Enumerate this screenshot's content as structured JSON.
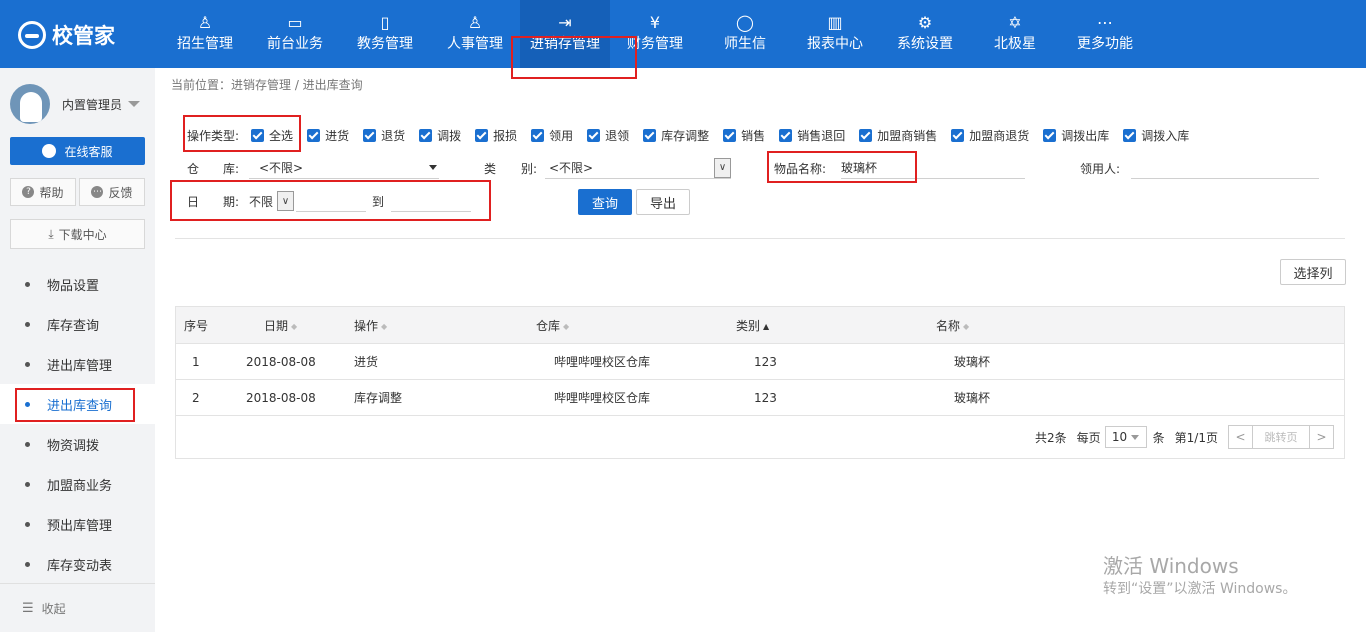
{
  "app": {
    "logo_text": "校管家"
  },
  "nav": [
    {
      "label": "招生管理",
      "icon": "user-plus-icon",
      "glyph": "♙"
    },
    {
      "label": "前台业务",
      "icon": "monitor-icon",
      "glyph": "▭"
    },
    {
      "label": "教务管理",
      "icon": "book-icon",
      "glyph": "▯"
    },
    {
      "label": "人事管理",
      "icon": "person-icon",
      "glyph": "♙"
    },
    {
      "label": "进销存管理",
      "icon": "inout-icon",
      "glyph": "⇥"
    },
    {
      "label": "财务管理",
      "icon": "yen-shield-icon",
      "glyph": "¥"
    },
    {
      "label": "师生信",
      "icon": "chat-bubble-icon",
      "glyph": "◯"
    },
    {
      "label": "报表中心",
      "icon": "chart-icon",
      "glyph": "▥"
    },
    {
      "label": "系统设置",
      "icon": "gear-icon",
      "glyph": "⚙"
    },
    {
      "label": "北极星",
      "icon": "star-icon",
      "glyph": "✡"
    },
    {
      "label": "更多功能",
      "icon": "more-icon",
      "glyph": "⋯"
    }
  ],
  "sidebar": {
    "user_name": "内置管理员",
    "service_button": "在线客服",
    "help_button": "帮助",
    "feedback_button": "反馈",
    "download_button": "下载中心",
    "items": [
      {
        "label": "物品设置"
      },
      {
        "label": "库存查询"
      },
      {
        "label": "进出库管理"
      },
      {
        "label": "进出库查询"
      },
      {
        "label": "物资调拨"
      },
      {
        "label": "加盟商业务"
      },
      {
        "label": "预出库管理"
      },
      {
        "label": "库存变动表"
      }
    ],
    "collapse_label": "收起"
  },
  "breadcrumb": "当前位置：进销存管理 / 进出库查询",
  "filters": {
    "op_type_label": "操作类型:",
    "op_types": [
      "全选",
      "进货",
      "退货",
      "调拨",
      "报损",
      "领用",
      "退领",
      "库存调整",
      "销售",
      "销售退回",
      "加盟商销售",
      "加盟商退货",
      "调拨出库",
      "调拨入库"
    ],
    "warehouse_label_1": "仓",
    "warehouse_label_2": "库:",
    "warehouse_value": "<不限>",
    "category_label_1": "类",
    "category_label_2": "别:",
    "category_value": "<不限>",
    "item_name_label": "物品名称:",
    "item_name_value": "玻璃杯",
    "recipient_label": "领用人:",
    "recipient_value": "",
    "date_label_1": "日",
    "date_label_2": "期:",
    "date_value": "不限",
    "date_to": "到",
    "query_button": "查询",
    "export_button": "导出"
  },
  "select_columns_button": "选择列",
  "table": {
    "headers": [
      "序号",
      "日期",
      "操作",
      "仓库",
      "类别",
      "名称"
    ],
    "rows": [
      [
        "1",
        "2018-08-08",
        "进货",
        "哔哩哔哩校区仓库",
        "123",
        "玻璃杯"
      ],
      [
        "2",
        "2018-08-08",
        "库存调整",
        "哔哩哔哩校区仓库",
        "123",
        "玻璃杯"
      ]
    ]
  },
  "pager": {
    "total": "共2条",
    "per_page_label": "每页",
    "per_page_value": "10",
    "per_page_unit": "条",
    "page_info": "第1/1页",
    "prev": "<",
    "jump": "跳转页",
    "next": ">"
  },
  "watermark": {
    "line1": "激活 Windows",
    "line2": "转到“设置”以激活 Windows。"
  },
  "colors": {
    "primary": "#1a6fd0",
    "highlight": "#e02020"
  }
}
